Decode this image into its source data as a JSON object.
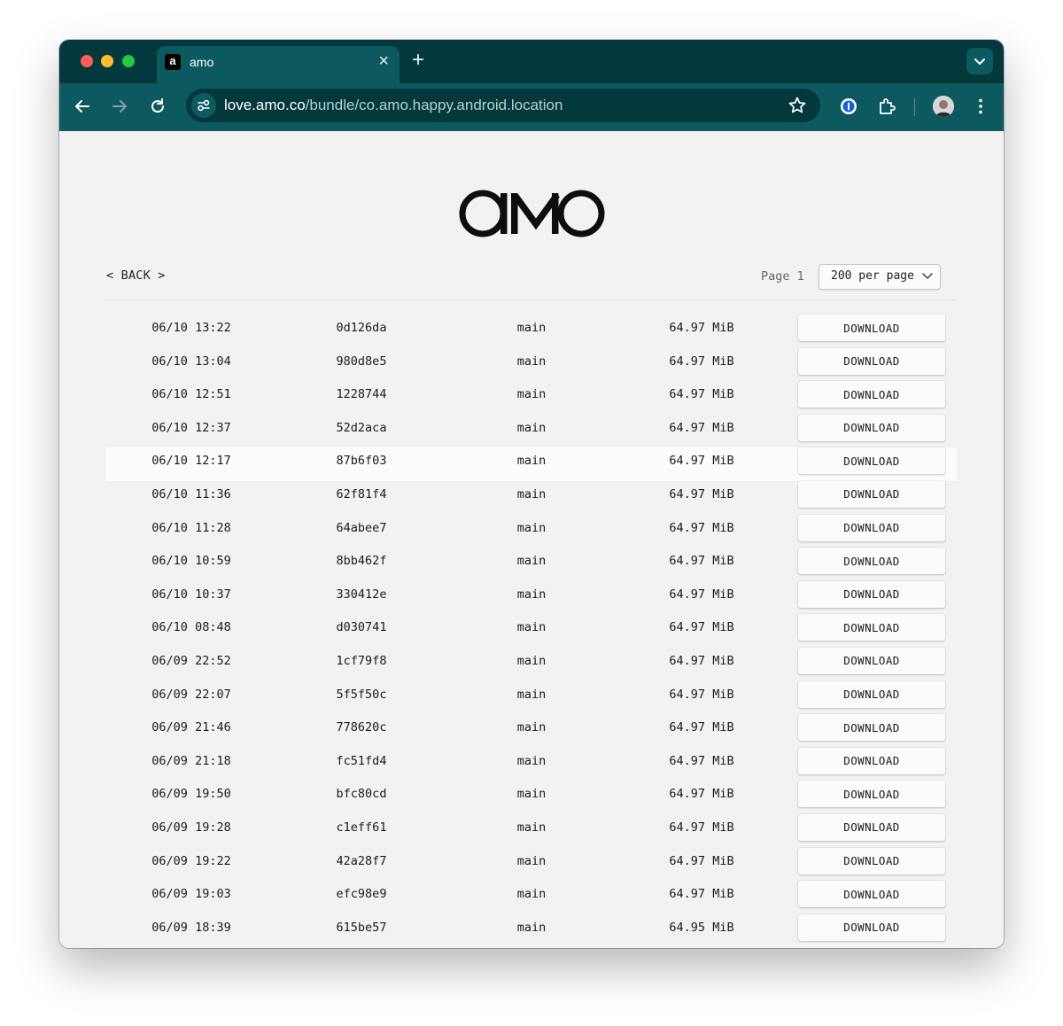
{
  "browser": {
    "tab_title": "amo",
    "tab_favicon_letter": "a",
    "url_host": "love.amo.co",
    "url_path": "/bundle/co.amo.happy.android.location"
  },
  "page": {
    "logo_text": "amo",
    "back_label": "< BACK >",
    "page_label": "Page 1",
    "per_page_selected": "200 per page",
    "download_label": "DOWNLOAD",
    "builds": [
      {
        "date": "06/10 13:22",
        "hash": "0d126da",
        "branch": "main",
        "size": "64.97 MiB"
      },
      {
        "date": "06/10 13:04",
        "hash": "980d8e5",
        "branch": "main",
        "size": "64.97 MiB"
      },
      {
        "date": "06/10 12:51",
        "hash": "1228744",
        "branch": "main",
        "size": "64.97 MiB"
      },
      {
        "date": "06/10 12:37",
        "hash": "52d2aca",
        "branch": "main",
        "size": "64.97 MiB"
      },
      {
        "date": "06/10 12:17",
        "hash": "87b6f03",
        "branch": "main",
        "size": "64.97 MiB",
        "highlighted": true
      },
      {
        "date": "06/10 11:36",
        "hash": "62f81f4",
        "branch": "main",
        "size": "64.97 MiB"
      },
      {
        "date": "06/10 11:28",
        "hash": "64abee7",
        "branch": "main",
        "size": "64.97 MiB"
      },
      {
        "date": "06/10 10:59",
        "hash": "8bb462f",
        "branch": "main",
        "size": "64.97 MiB"
      },
      {
        "date": "06/10 10:37",
        "hash": "330412e",
        "branch": "main",
        "size": "64.97 MiB"
      },
      {
        "date": "06/10 08:48",
        "hash": "d030741",
        "branch": "main",
        "size": "64.97 MiB"
      },
      {
        "date": "06/09 22:52",
        "hash": "1cf79f8",
        "branch": "main",
        "size": "64.97 MiB"
      },
      {
        "date": "06/09 22:07",
        "hash": "5f5f50c",
        "branch": "main",
        "size": "64.97 MiB"
      },
      {
        "date": "06/09 21:46",
        "hash": "778620c",
        "branch": "main",
        "size": "64.97 MiB"
      },
      {
        "date": "06/09 21:18",
        "hash": "fc51fd4",
        "branch": "main",
        "size": "64.97 MiB"
      },
      {
        "date": "06/09 19:50",
        "hash": "bfc80cd",
        "branch": "main",
        "size": "64.97 MiB"
      },
      {
        "date": "06/09 19:28",
        "hash": "c1eff61",
        "branch": "main",
        "size": "64.97 MiB"
      },
      {
        "date": "06/09 19:22",
        "hash": "42a28f7",
        "branch": "main",
        "size": "64.97 MiB"
      },
      {
        "date": "06/09 19:03",
        "hash": "efc98e9",
        "branch": "main",
        "size": "64.97 MiB"
      },
      {
        "date": "06/09 18:39",
        "hash": "615be57",
        "branch": "main",
        "size": "64.95 MiB"
      }
    ]
  },
  "colors": {
    "tabbar": "#03393d",
    "toolbar": "#0c5a5f",
    "page_background": "#f3f2f0",
    "row_highlight": "#fbfbfa"
  },
  "icons": [
    "close-icon",
    "plus-icon",
    "chevron-down-icon",
    "back-arrow-icon",
    "forward-arrow-icon",
    "reload-icon",
    "site-settings-icon",
    "star-icon",
    "password-manager-icon",
    "extensions-icon",
    "profile-avatar",
    "more-menu-icon"
  ]
}
